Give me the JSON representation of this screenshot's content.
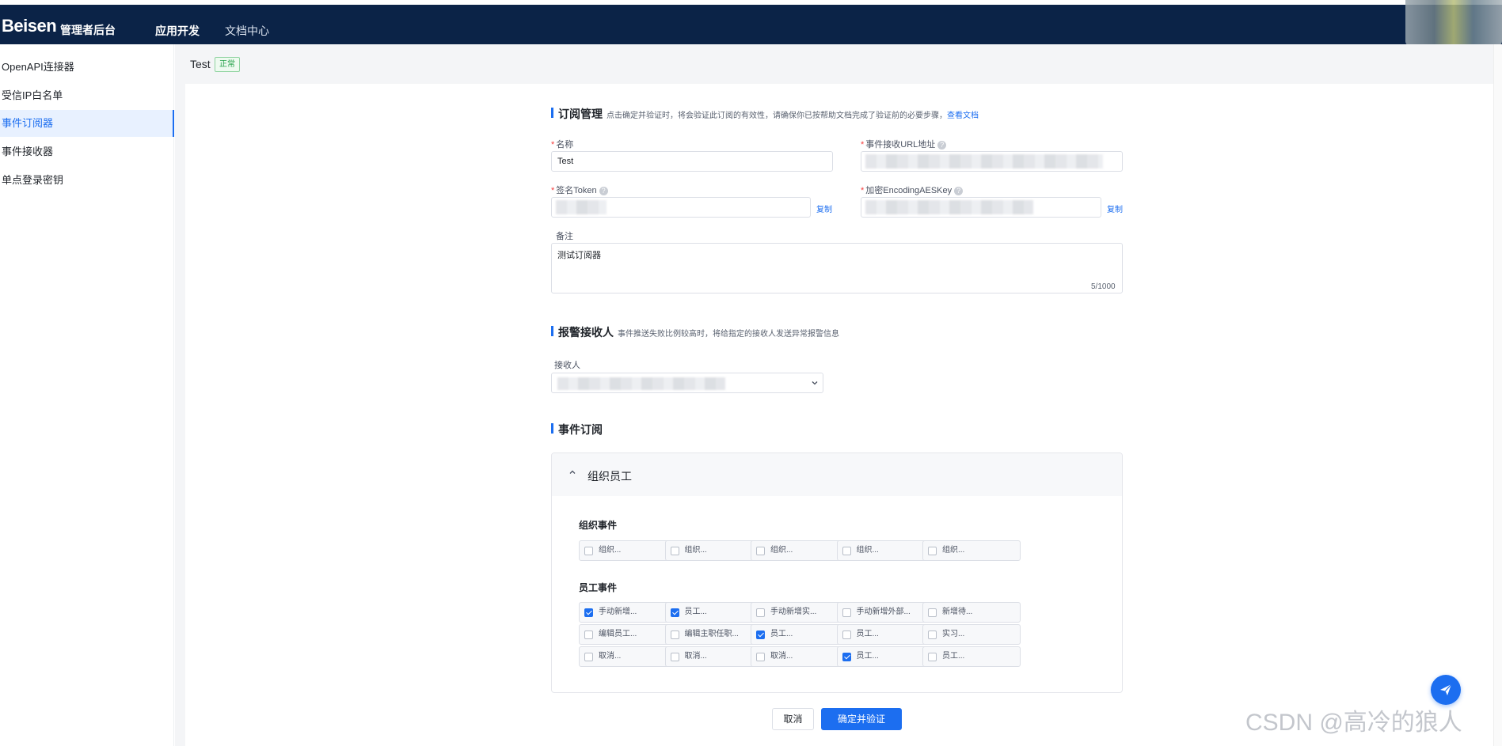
{
  "header": {
    "logo": "Beisen",
    "logo_sub": "管理者后台",
    "nav": [
      {
        "label": "应用开发",
        "active": true
      },
      {
        "label": "文档中心",
        "active": false
      }
    ]
  },
  "sidebar": {
    "items": [
      {
        "label": "OpenAPI连接器"
      },
      {
        "label": "受信IP白名单"
      },
      {
        "label": "事件订阅器",
        "active": true
      },
      {
        "label": "事件接收器"
      },
      {
        "label": "单点登录密钥"
      }
    ]
  },
  "page": {
    "title": "Test",
    "status": "正常"
  },
  "subscription": {
    "title": "订阅管理",
    "desc": "点击确定并验证时，将会验证此订阅的有效性，请确保你已按帮助文档完成了验证前的必要步骤，",
    "doc_link": "查看文档",
    "name_label": "名称",
    "name_value": "Test",
    "url_label": "事件接收URL地址",
    "token_label": "签名Token",
    "aes_label": "加密EncodingAESKey",
    "copy_label": "复制",
    "remark_label": "备注",
    "remark_value": "测试订阅器",
    "remark_counter": "5/1000",
    "help_glyph": "?"
  },
  "alarm": {
    "title": "报警接收人",
    "desc": "事件推送失败比例较高时，将给指定的接收人发送异常报警信息",
    "receiver_label": "接收人"
  },
  "events": {
    "title": "事件订阅",
    "group_title": "组织员工",
    "org_title": "组织事件",
    "org_items": [
      {
        "label": "组织...",
        "checked": false
      },
      {
        "label": "组织...",
        "checked": false
      },
      {
        "label": "组织...",
        "checked": false
      },
      {
        "label": "组织...",
        "checked": false
      },
      {
        "label": "组织...",
        "checked": false
      }
    ],
    "emp_title": "员工事件",
    "emp_items": [
      {
        "label": "手动新增...",
        "checked": true
      },
      {
        "label": "员工...",
        "checked": true
      },
      {
        "label": "手动新增实...",
        "checked": false
      },
      {
        "label": "手动新增外部...",
        "checked": false
      },
      {
        "label": "新增待...",
        "checked": false
      },
      {
        "label": "编辑员工...",
        "checked": false
      },
      {
        "label": "编辑主职任职...",
        "checked": false
      },
      {
        "label": "员工...",
        "checked": true
      },
      {
        "label": "员工...",
        "checked": false
      },
      {
        "label": "实习...",
        "checked": false
      },
      {
        "label": "取消...",
        "checked": false
      },
      {
        "label": "取消...",
        "checked": false
      },
      {
        "label": "取消...",
        "checked": false
      },
      {
        "label": "员工...",
        "checked": true
      },
      {
        "label": "员工...",
        "checked": false
      }
    ]
  },
  "footer": {
    "cancel": "取消",
    "confirm": "确定并验证"
  },
  "watermark": "CSDN @高冷的狼人",
  "colors": {
    "primary": "#1c6ef0",
    "header_bg": "#0b2347",
    "success": "#24a148"
  }
}
